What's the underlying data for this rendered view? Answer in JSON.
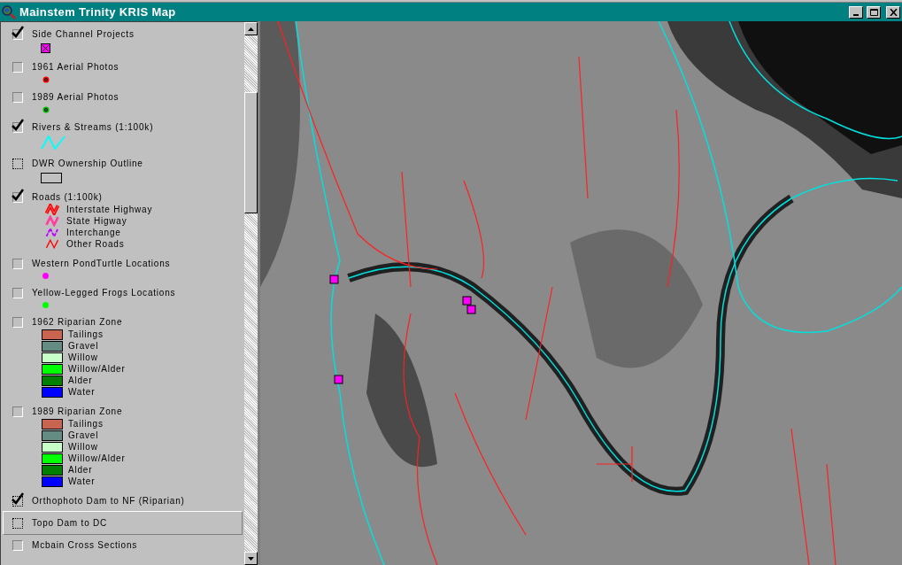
{
  "window": {
    "title": "Mainstem Trinity KRIS Map"
  },
  "layers": [
    {
      "label": "Side Channel Projects",
      "checked": true,
      "dotted": false,
      "selected": false,
      "legend": {
        "kind": "box-x",
        "color": "#ff00ff"
      }
    },
    {
      "label": "1961 Aerial Photos",
      "checked": false,
      "dotted": false,
      "selected": false,
      "legend": {
        "kind": "ring",
        "color": "#ff0000"
      }
    },
    {
      "label": "1989 Aerial Photos",
      "checked": false,
      "dotted": false,
      "selected": false,
      "legend": {
        "kind": "ring",
        "color": "#00c000"
      }
    },
    {
      "label": "Rivers & Streams (1:100k)",
      "checked": true,
      "dotted": false,
      "selected": false,
      "legend": {
        "kind": "zigzag",
        "color": "#00ffff"
      }
    },
    {
      "label": "DWR Ownership Outline",
      "checked": false,
      "dotted": true,
      "selected": false,
      "legend": {
        "kind": "outline"
      }
    },
    {
      "label": "Roads (1:100k)",
      "checked": true,
      "dotted": false,
      "selected": false,
      "legend": {
        "kind": "lines",
        "items": [
          {
            "label": "Interstate Highway",
            "kind": "double",
            "color": "#ff0000"
          },
          {
            "label": "State Higway",
            "kind": "thick",
            "color": "#ff3fa0"
          },
          {
            "label": "Interchange",
            "kind": "dashed",
            "color": "#c000ff"
          },
          {
            "label": "Other Roads",
            "kind": "thin",
            "color": "#ff0000"
          }
        ]
      }
    },
    {
      "label": "Western PondTurtle Locations",
      "checked": false,
      "dotted": false,
      "selected": false,
      "legend": {
        "kind": "dot",
        "color": "#ff00ff"
      }
    },
    {
      "label": "Yellow-Legged Frogs Locations",
      "checked": false,
      "dotted": false,
      "selected": false,
      "legend": {
        "kind": "dot",
        "color": "#00ff00"
      }
    },
    {
      "label": "1962 Riparian Zone",
      "checked": false,
      "dotted": false,
      "selected": false,
      "legend": {
        "kind": "classes",
        "items": [
          {
            "label": "Tailings",
            "color": "#c86450"
          },
          {
            "label": "Gravel",
            "color": "#648c82"
          },
          {
            "label": "Willow",
            "color": "#c8ffc8"
          },
          {
            "label": "Willow/Alder",
            "color": "#00ff00"
          },
          {
            "label": "Alder",
            "color": "#008000"
          },
          {
            "label": "Water",
            "color": "#0000ff"
          }
        ]
      }
    },
    {
      "label": "1989 Riparian Zone",
      "checked": false,
      "dotted": false,
      "selected": false,
      "legend": {
        "kind": "classes",
        "items": [
          {
            "label": "Tailings",
            "color": "#c86450"
          },
          {
            "label": "Gravel",
            "color": "#648c82"
          },
          {
            "label": "Willow",
            "color": "#c8ffc8"
          },
          {
            "label": "Willow/Alder",
            "color": "#00ff00"
          },
          {
            "label": "Alder",
            "color": "#008000"
          },
          {
            "label": "Water",
            "color": "#0000ff"
          }
        ]
      }
    },
    {
      "label": "Orthophoto Dam to NF (Riparian)",
      "checked": true,
      "dotted": true,
      "selected": false
    },
    {
      "label": "Topo Dam to DC",
      "checked": false,
      "dotted": true,
      "selected": true
    },
    {
      "label": "Mcbain Cross Sections",
      "checked": false,
      "dotted": false,
      "selected": false
    }
  ]
}
